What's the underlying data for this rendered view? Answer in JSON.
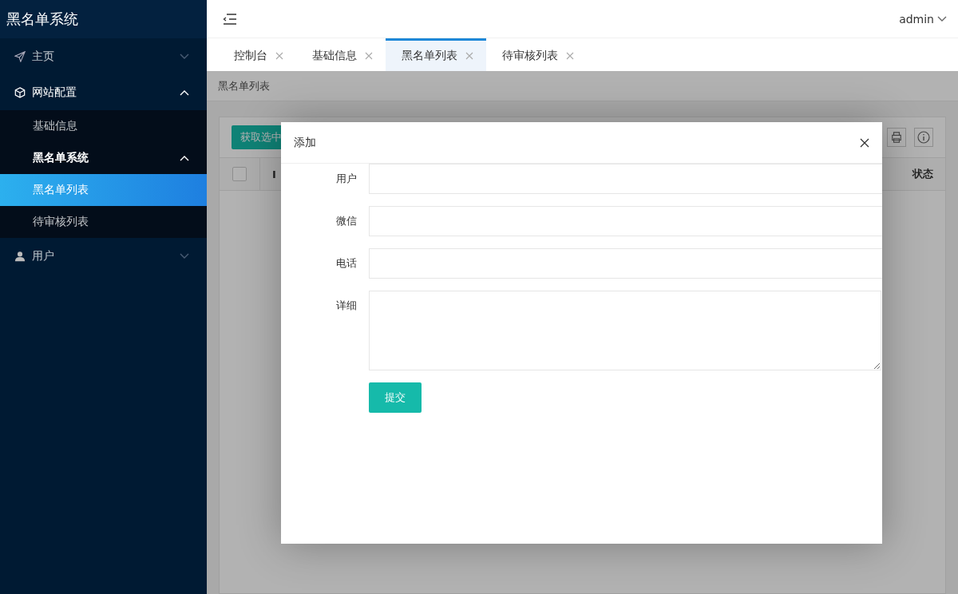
{
  "app_title": "黑名单系统",
  "sidebar": {
    "items": [
      {
        "label": "主页",
        "kind": "send",
        "expanded": false,
        "selected": false
      },
      {
        "label": "网站配置",
        "kind": "cube",
        "expanded": true,
        "selected": false,
        "children": [
          {
            "label": "基础信息",
            "selected": false
          },
          {
            "label": "黑名单系统",
            "expanded": true,
            "selected": false,
            "children": [
              {
                "label": "黑名单列表",
                "selected": true
              },
              {
                "label": "待审核列表",
                "selected": false
              }
            ]
          }
        ]
      },
      {
        "label": "用户",
        "kind": "user",
        "expanded": false,
        "selected": false
      }
    ]
  },
  "header": {
    "user": "admin"
  },
  "tabs": [
    {
      "label": "控制台",
      "selected": false
    },
    {
      "label": "基础信息",
      "selected": false
    },
    {
      "label": "黑名单列表",
      "selected": true
    },
    {
      "label": "待审核列表",
      "selected": false
    }
  ],
  "page": {
    "breadcrumb": "黑名单列表",
    "toolbar_button": "获取选中",
    "table": {
      "columns": [
        "I",
        "状态"
      ],
      "select_all": false
    }
  },
  "dialog": {
    "title": "添加",
    "fields": [
      {
        "label": "用户",
        "kind": "input"
      },
      {
        "label": "微信",
        "kind": "input"
      },
      {
        "label": "电话",
        "kind": "input"
      },
      {
        "label": "详细",
        "kind": "textarea"
      }
    ],
    "submit": "提交"
  }
}
